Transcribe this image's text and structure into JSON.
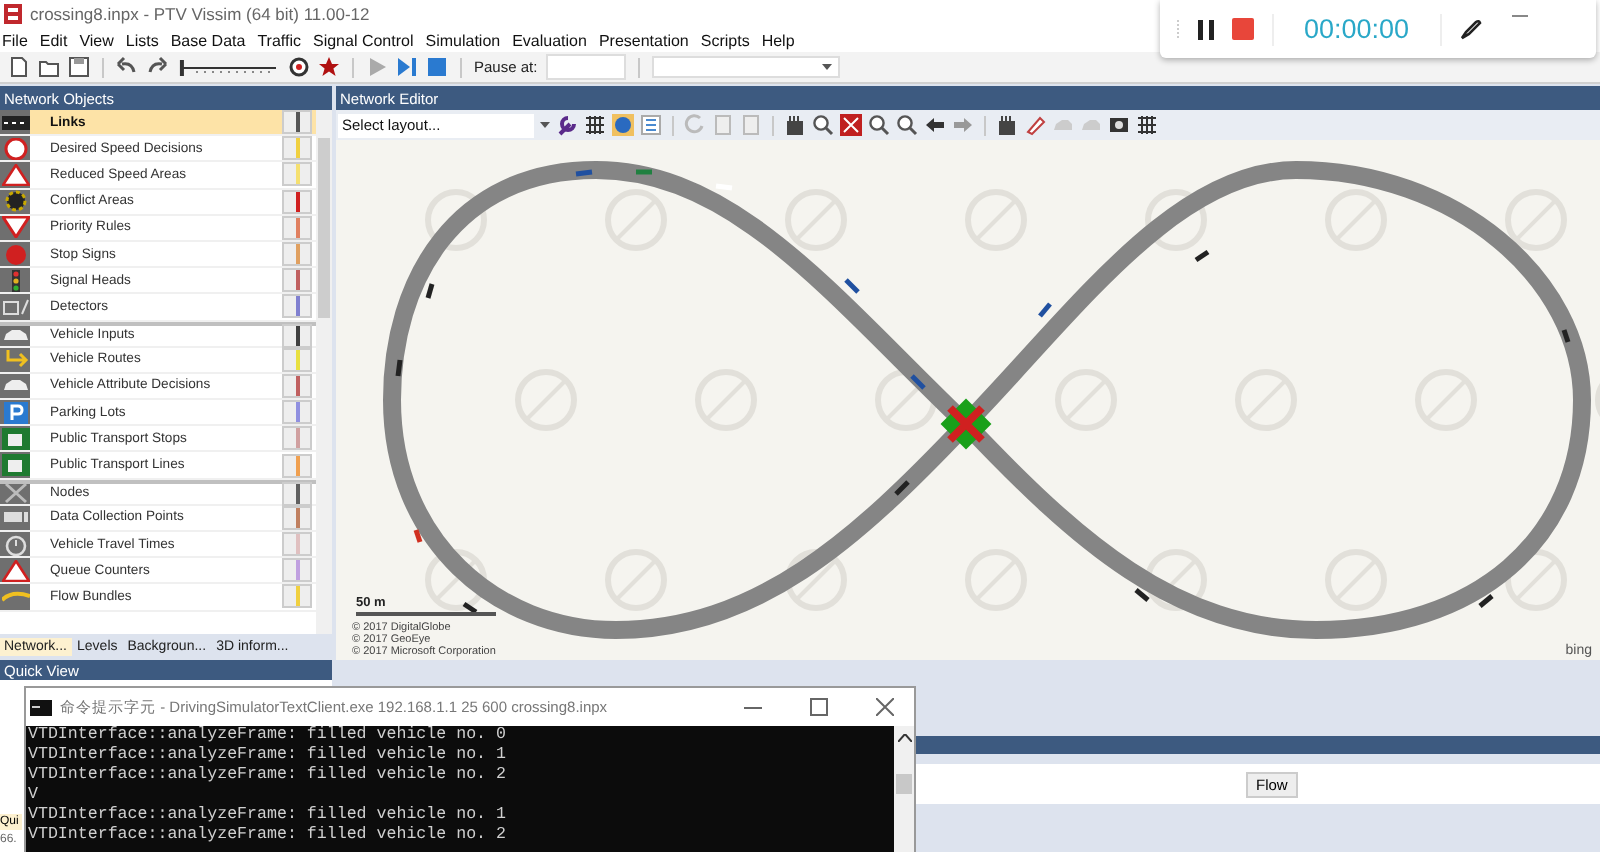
{
  "window": {
    "title": "crossing8.inpx - PTV Vissim (64 bit) 11.00-12"
  },
  "menu": [
    "File",
    "Edit",
    "View",
    "Lists",
    "Base Data",
    "Traffic",
    "Signal Control",
    "Simulation",
    "Evaluation",
    "Presentation",
    "Scripts",
    "Help"
  ],
  "toolbar": {
    "speed_slider": {
      "level": 0.02
    },
    "pause_label": "Pause at:"
  },
  "recorder": {
    "time": "00:00:00"
  },
  "network_objects": {
    "title": "Network Objects",
    "groups": [
      {
        "items": [
          {
            "label": "Links",
            "selected": true,
            "color": "#555555"
          },
          {
            "label": "Desired Speed Decisions",
            "selected": false,
            "color": "#f0d040"
          },
          {
            "label": "Reduced Speed Areas",
            "selected": false,
            "color": "#f5e070"
          },
          {
            "label": "Conflict Areas",
            "selected": false,
            "color": "#d02020"
          },
          {
            "label": "Priority Rules",
            "selected": false,
            "color": "#e08060"
          },
          {
            "label": "Stop Signs",
            "selected": false,
            "color": "#e0a060"
          },
          {
            "label": "Signal Heads",
            "selected": false,
            "color": "#c06060"
          },
          {
            "label": "Detectors",
            "selected": false,
            "color": "#8080d0"
          }
        ]
      },
      {
        "items": [
          {
            "label": "Vehicle Inputs",
            "selected": false,
            "color": "#404040"
          },
          {
            "label": "Vehicle Routes",
            "selected": false,
            "color": "#e8e040"
          },
          {
            "label": "Vehicle Attribute Decisions",
            "selected": false,
            "color": "#c06060"
          },
          {
            "label": "Parking Lots",
            "selected": false,
            "color": "#9090e0"
          },
          {
            "label": "Public Transport Stops",
            "selected": false,
            "color": "#d0a0a0"
          },
          {
            "label": "Public Transport Lines",
            "selected": false,
            "color": "#f0a050"
          }
        ]
      },
      {
        "items": [
          {
            "label": "Nodes",
            "selected": false,
            "color": "#606060"
          },
          {
            "label": "Data Collection Points",
            "selected": false,
            "color": "#c08060"
          },
          {
            "label": "Vehicle Travel Times",
            "selected": false,
            "color": "#e0c0c0"
          },
          {
            "label": "Queue Counters",
            "selected": false,
            "color": "#c0a0e0"
          },
          {
            "label": "Flow Bundles",
            "selected": false,
            "color": "#f0d040"
          }
        ]
      }
    ]
  },
  "panel_tabs": [
    {
      "label": "Network...",
      "selected": true
    },
    {
      "label": "Levels",
      "selected": false
    },
    {
      "label": "Backgroun...",
      "selected": false
    },
    {
      "label": "3D inform...",
      "selected": false
    }
  ],
  "quick_view": {
    "title": "Quick View",
    "tab": "Qui",
    "value": "66."
  },
  "editor": {
    "title": "Network Editor",
    "layout_select": "Select layout...",
    "scale": "50 m",
    "credits": [
      "© 2017 DigitalGlobe",
      "© 2017 GeoEye",
      "© 2017 Microsoft Corporation"
    ],
    "map_logo": "bing"
  },
  "lower_panel": {
    "button": "Flow"
  },
  "console": {
    "title": "命令提示字元 - DrivingSimulatorTextClient.exe  192.168.1.1 25 600 crossing8.inpx",
    "lines": [
      "VTDInterface::analyzeFrame: filled vehicle no. 0",
      "VTDInterface::analyzeFrame: filled vehicle no. 1",
      "VTDInterface::analyzeFrame: filled vehicle no. 2",
      "V",
      "VTDInterface::analyzeFrame: filled vehicle no. 1",
      "VTDInterface::analyzeFrame: filled vehicle no. 2"
    ]
  }
}
